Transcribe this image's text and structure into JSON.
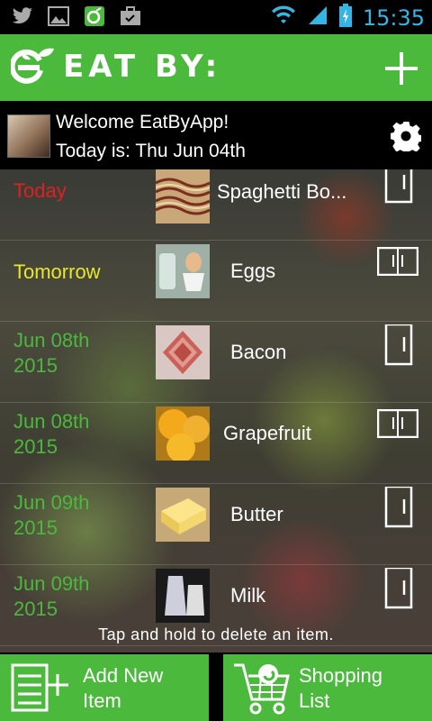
{
  "status_bar": {
    "icons_left": [
      "twitter-icon",
      "gallery-icon",
      "eatby-app-icon",
      "briefcase-icon"
    ],
    "icons_right": [
      "wifi-icon",
      "signal-icon",
      "battery-icon"
    ],
    "time": "15:35"
  },
  "header": {
    "app_name": "EAT BY:",
    "add_icon": "plus-icon",
    "accent": "#4bb93c"
  },
  "welcome": {
    "greeting": "Welcome EatByApp!",
    "today": "Today is: Thu Jun 04th",
    "settings_icon": "gear-icon"
  },
  "items": [
    {
      "date_line1": "Today",
      "date_line2": "",
      "date_color": "#e02020",
      "name": "Spaghetti Bo...",
      "thumb": "spaghetti",
      "storage": "fridge"
    },
    {
      "date_line1": "Tomorrow",
      "date_line2": "",
      "date_color": "#e8e82a",
      "name": "Eggs",
      "thumb": "eggs",
      "storage": "side-by-side-fridge"
    },
    {
      "date_line1": "Jun 08th",
      "date_line2": "2015",
      "date_color": "#4bb93c",
      "name": "Bacon",
      "thumb": "bacon",
      "storage": "fridge"
    },
    {
      "date_line1": "Jun 08th",
      "date_line2": "2015",
      "date_color": "#4bb93c",
      "name": "Grapefruit",
      "thumb": "grapefruit",
      "storage": "side-by-side-fridge"
    },
    {
      "date_line1": "Jun 09th",
      "date_line2": "2015",
      "date_color": "#4bb93c",
      "name": "Butter",
      "thumb": "butter",
      "storage": "fridge"
    },
    {
      "date_line1": "Jun 09th",
      "date_line2": "2015",
      "date_color": "#4bb93c",
      "name": "Milk",
      "thumb": "milk",
      "storage": "fridge"
    }
  ],
  "hint": "Tap and hold to delete an item.",
  "buttons": {
    "add_new_line1": "Add New",
    "add_new_line2": "Item",
    "shopping_line1": "Shopping",
    "shopping_line2": "List"
  }
}
